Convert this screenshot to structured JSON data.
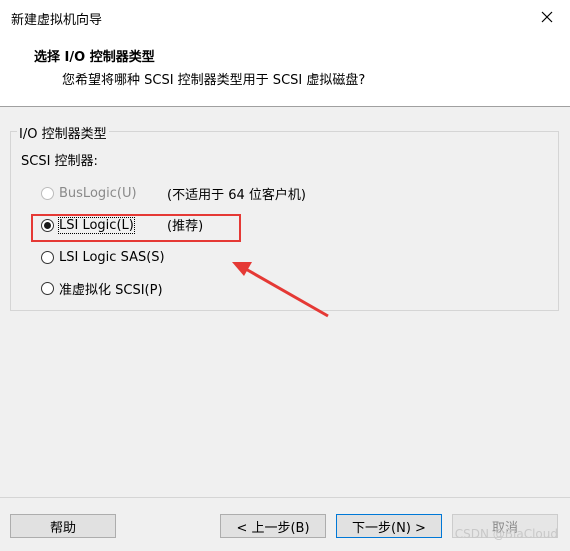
{
  "window": {
    "title": "新建虚拟机向导"
  },
  "header": {
    "title": "选择 I/O 控制器类型",
    "subtitle": "您希望将哪种 SCSI 控制器类型用于 SCSI 虚拟磁盘?"
  },
  "group": {
    "legend": "I/O 控制器类型",
    "scsi_label": "SCSI 控制器:"
  },
  "options": [
    {
      "label": "BusLogic(U)",
      "note": "(不适用于 64 位客户机)",
      "checked": false,
      "disabled": true
    },
    {
      "label": "LSI Logic(L)",
      "note": "(推荐)",
      "checked": true,
      "disabled": false
    },
    {
      "label": "LSI Logic SAS(S)",
      "note": "",
      "checked": false,
      "disabled": false
    },
    {
      "label": "准虚拟化 SCSI(P)",
      "note": "",
      "checked": false,
      "disabled": false
    }
  ],
  "buttons": {
    "help": "帮助",
    "back": "< 上一步(B)",
    "next": "下一步(N) >",
    "cancel": "取消"
  },
  "annotation_color": "#e53935",
  "watermark": "CSDN @BiaCloud"
}
